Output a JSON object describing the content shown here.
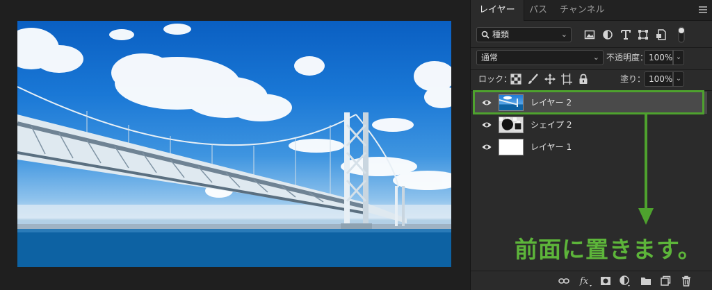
{
  "tabs": [
    {
      "label": "レイヤー",
      "active": true
    },
    {
      "label": "パス",
      "active": false
    },
    {
      "label": "チャンネル",
      "active": false
    }
  ],
  "filter": {
    "value": "種類"
  },
  "blend_mode": {
    "value": "通常"
  },
  "opacity": {
    "label": "不透明度：",
    "value": "100%"
  },
  "lock": {
    "label": "ロック："
  },
  "fill": {
    "label": "塗り：",
    "value": "100%"
  },
  "layers": [
    {
      "name": "レイヤー 2",
      "selected": true,
      "visible": true
    },
    {
      "name": "シェイプ 2",
      "selected": false,
      "visible": true
    },
    {
      "name": "レイヤー 1",
      "selected": false,
      "visible": true
    }
  ],
  "annotation": {
    "text": "前面に置きます。"
  },
  "colors": {
    "accent_green": "#4ea22e",
    "panel_bg": "#2b2b2b",
    "selected_row": "#4a4a4a"
  },
  "icons": {
    "filter_bar": [
      "image-filter-icon",
      "adjustment-filter-icon",
      "type-filter-icon",
      "shape-filter-icon",
      "smart-object-filter-icon",
      "filter-toggle-icon"
    ],
    "lock_bar": [
      "lock-transparent-icon",
      "lock-image-icon",
      "lock-position-icon",
      "lock-artboard-icon",
      "lock-all-icon"
    ],
    "bottom_bar": [
      "link-layers-icon",
      "fx-icon",
      "mask-icon",
      "adjustment-layer-icon",
      "group-folder-icon",
      "new-layer-icon",
      "trash-icon"
    ]
  }
}
